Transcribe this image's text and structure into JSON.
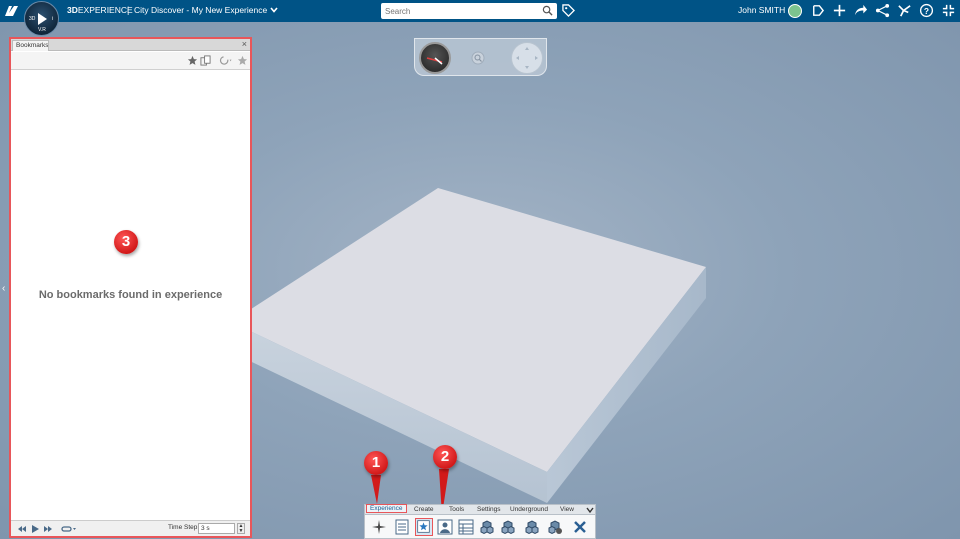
{
  "topbar": {
    "brand_bold": "3D",
    "brand_light": "EXPERIENCE",
    "separator": "|",
    "app_title": "City Discover - My New Experience",
    "search_placeholder": "Search",
    "user_name": "John SMITH",
    "compass_version": "V.R",
    "compass_3d": "3D",
    "compass_i": "i",
    "icons": [
      "tag-icon",
      "recent-icon",
      "add-icon",
      "share-icon",
      "network-icon",
      "apps-icon",
      "help-icon",
      "fullscreen-icon"
    ]
  },
  "panel": {
    "tab_label": "Bookmarks",
    "close_label": "×",
    "empty_message": "No bookmarks found in experience",
    "time_step_label": "Time Step:",
    "time_step_value": "3 s",
    "toolbar_icons": [
      "add-bookmark-icon",
      "folder-icon",
      "refresh-icon",
      "favorite-icon"
    ]
  },
  "callouts": [
    "1",
    "2",
    "3"
  ],
  "actionbar": {
    "tabs": [
      "Experience",
      "Create",
      "Tools",
      "Settings",
      "Underground",
      "View"
    ],
    "active_tab": "Experience",
    "tools": [
      "compass-tool-icon",
      "list-tool-icon",
      "bookmarks-tool-icon",
      "image-tool-icon",
      "table-tool-icon",
      "cube-tool-icon",
      "cubes-tool-icon",
      "cubes-alt-tool-icon",
      "cubes-settings-tool-icon",
      "close-tool-icon"
    ],
    "selected_tool": "bookmarks-tool-icon"
  },
  "colors": {
    "topbar": "#005386",
    "highlight": "#e8565a",
    "callout": "#d21a1a",
    "slab": "#dcdde4",
    "sky": "#8b9fb6"
  }
}
